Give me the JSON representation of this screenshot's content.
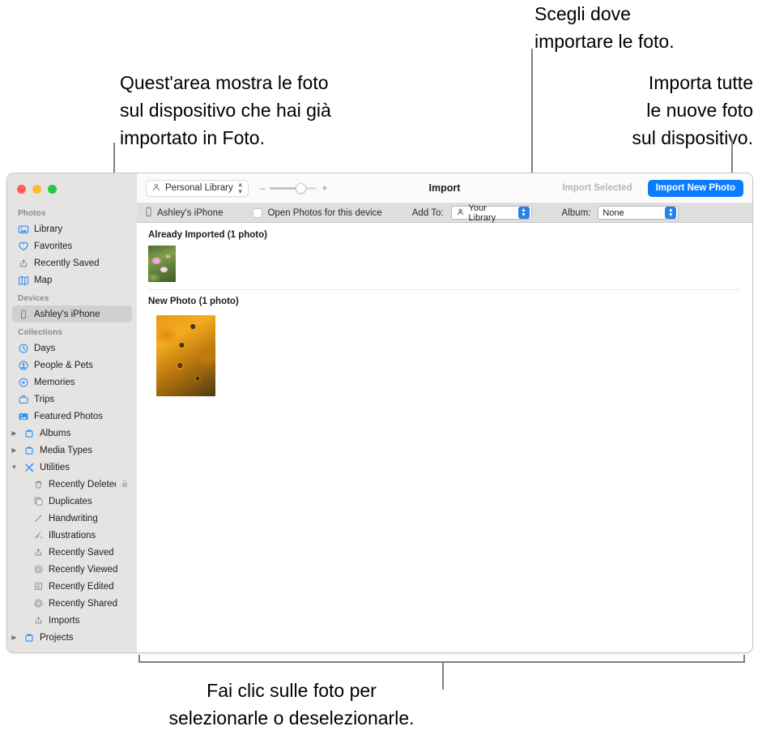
{
  "callouts": {
    "area": "Quest'area mostra le foto\nsul dispositivo che hai già\nimportato in Foto.",
    "choose": "Scegli dove\nimportare le foto.",
    "import_all": "Importa tutte\nle nuove foto\nsul dispositivo.",
    "click": "Fai clic sulle foto per\nselezionarle o deselezionarle."
  },
  "window": {
    "traffic_lights": [
      "close",
      "minimize",
      "zoom"
    ]
  },
  "sidebar": {
    "sections": [
      {
        "title": "Photos",
        "items": [
          {
            "label": "Library",
            "icon": "library-icon"
          },
          {
            "label": "Favorites",
            "icon": "heart-icon"
          },
          {
            "label": "Recently Saved",
            "icon": "save-icon"
          },
          {
            "label": "Map",
            "icon": "map-icon"
          }
        ]
      },
      {
        "title": "Devices",
        "items": [
          {
            "label": "Ashley's iPhone",
            "icon": "iphone-icon",
            "selected": true
          }
        ]
      },
      {
        "title": "Collections",
        "items": [
          {
            "label": "Days",
            "icon": "clock-icon"
          },
          {
            "label": "People & Pets",
            "icon": "person-icon"
          },
          {
            "label": "Memories",
            "icon": "memories-icon"
          },
          {
            "label": "Trips",
            "icon": "trips-icon"
          },
          {
            "label": "Featured Photos",
            "icon": "featured-photos-icon"
          },
          {
            "label": "Albums",
            "icon": "folder-icon",
            "disclosure": "collapsed"
          },
          {
            "label": "Media Types",
            "icon": "folder-icon",
            "disclosure": "collapsed"
          },
          {
            "label": "Utilities",
            "icon": "utilities-icon",
            "disclosure": "expanded"
          },
          {
            "label": "Recently Deleted",
            "icon": "trash-icon",
            "indent": true,
            "badge": "lock-icon"
          },
          {
            "label": "Duplicates",
            "icon": "duplicates-icon",
            "indent": true
          },
          {
            "label": "Handwriting",
            "icon": "handwriting-icon",
            "indent": true
          },
          {
            "label": "Illustrations",
            "icon": "illustrations-icon",
            "indent": true
          },
          {
            "label": "Recently Saved",
            "icon": "save-icon",
            "indent": true
          },
          {
            "label": "Recently Viewed",
            "icon": "viewed-icon",
            "indent": true
          },
          {
            "label": "Recently Edited",
            "icon": "edited-icon",
            "indent": true
          },
          {
            "label": "Recently Shared",
            "icon": "shared-icon",
            "indent": true
          },
          {
            "label": "Imports",
            "icon": "save-icon",
            "indent": true
          },
          {
            "label": "Projects",
            "icon": "folder-icon",
            "disclosure": "collapsed"
          }
        ]
      }
    ]
  },
  "toolbar": {
    "library_picker": "Personal Library",
    "zoom_minus": "–",
    "zoom_plus": "+",
    "title": "Import",
    "import_selected": "Import Selected",
    "import_new_photo": "Import New Photo"
  },
  "subbar": {
    "device": "Ashley's iPhone",
    "open_photos_label": "Open Photos for this device",
    "open_photos_checked": false,
    "add_to_label": "Add To:",
    "add_to_value": "Your Library",
    "album_label": "Album:",
    "album_value": "None"
  },
  "content": {
    "groups": [
      {
        "title": "Already Imported (1 photo)",
        "size": "small",
        "photos": [
          "pink-flowers-thumbnail"
        ]
      },
      {
        "title": "New Photo (1 photo)",
        "size": "big",
        "photos": [
          "orange-sunflowers-thumbnail"
        ]
      }
    ]
  },
  "colors": {
    "accent": "#0a7cff",
    "sidebar_bg": "#e6e4e3",
    "subbar_bg": "#dededc",
    "leader_line": "#808080"
  }
}
